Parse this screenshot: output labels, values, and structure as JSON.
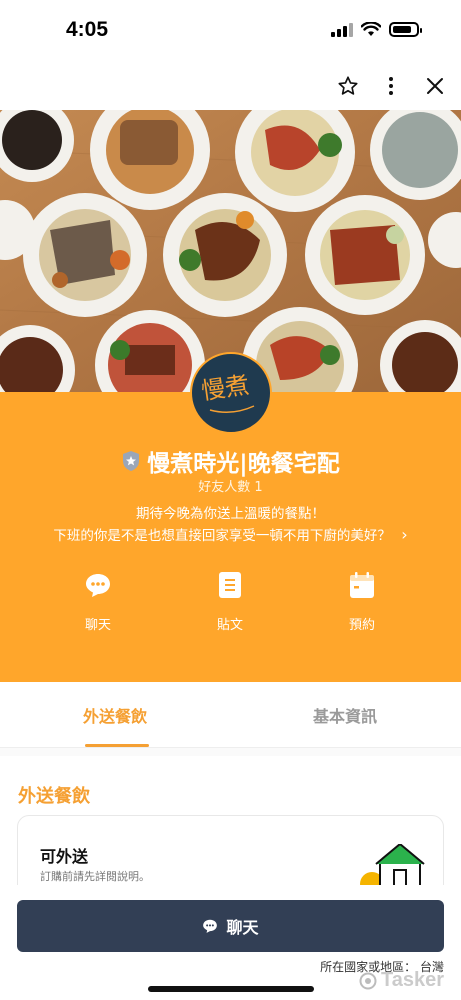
{
  "status_bar": {
    "time": "4:05"
  },
  "account": {
    "name": "慢煮時光|晚餐宅配",
    "friends": "好友人數 1",
    "description_line1": "期待今晚為你送上溫暖的餐點！",
    "description_line2": "下班的你是不是也想直接回家享受一頓不用下廚的美好？",
    "more_chevron": "›",
    "avatar_text": "慢煮"
  },
  "actions": [
    {
      "label": "聊天",
      "icon": "chat-bubble-icon"
    },
    {
      "label": "貼文",
      "icon": "post-document-icon"
    },
    {
      "label": "預約",
      "icon": "calendar-icon"
    }
  ],
  "tabs": [
    {
      "label": "外送餐飲",
      "active": true
    },
    {
      "label": "基本資訊",
      "active": false
    }
  ],
  "section": {
    "title": "外送餐飲",
    "card_title": "可外送",
    "card_subtitle": "訂購前請先詳閱說明。"
  },
  "bottom": {
    "chat_button_label": "聊天",
    "region": "所在國家或地區： 台灣",
    "watermark": "Tasker"
  },
  "colors": {
    "accent": "#ffa62b",
    "tab_active": "#f5a033",
    "chat_button": "#323f55",
    "avatar_bg": "#1f3a4f"
  }
}
